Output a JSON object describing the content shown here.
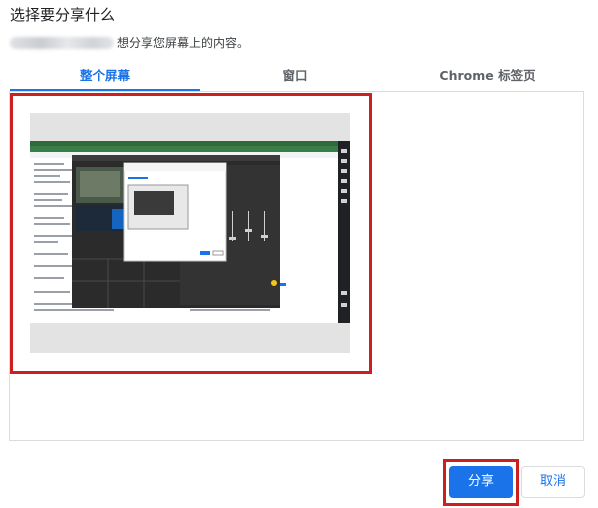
{
  "dialog": {
    "title": "选择要分享什么",
    "subtitle": "想分享您屏幕上的内容。"
  },
  "tabs": [
    {
      "label": "整个屏幕",
      "active": true
    },
    {
      "label": "窗口",
      "active": false
    },
    {
      "label": "Chrome 标签页",
      "active": false
    }
  ],
  "buttons": {
    "share_label": "分享",
    "cancel_label": "取消"
  },
  "colors": {
    "accent": "#1a73e8",
    "annotation": "#cc1f1f"
  }
}
